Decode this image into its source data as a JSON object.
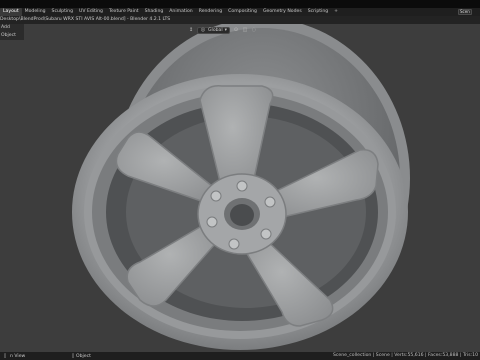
{
  "menubar": {
    "tabs": [
      "Layout",
      "Modeling",
      "Sculpting",
      "UV Editing",
      "Texture Paint",
      "Shading",
      "Animation",
      "Rendering",
      "Compositing",
      "Geometry Nodes",
      "Scripting"
    ],
    "active_tab": "Layout",
    "add_tab_label": "+",
    "scene_label": "Scen"
  },
  "titlebar": {
    "text": "Desktop\\BlendProd\\Subaru WRX STI AVIS Alt-00.blend] - Blender 4.2.1 LTS"
  },
  "leftstrip": {
    "row1": "Add",
    "row2": "Object"
  },
  "viewport_header": {
    "orientation_label": "Global"
  },
  "status": {
    "left_label": "n View",
    "mid_label": "Object",
    "right_text": "Scene_collection | Scene | Verts:55,616 | Faces:53,888 | Tris:10"
  },
  "colors": {
    "viewport_bg": "#3d3d3d",
    "model_gray": "#a3a5a6",
    "ui_dark": "#1f1f1f"
  }
}
